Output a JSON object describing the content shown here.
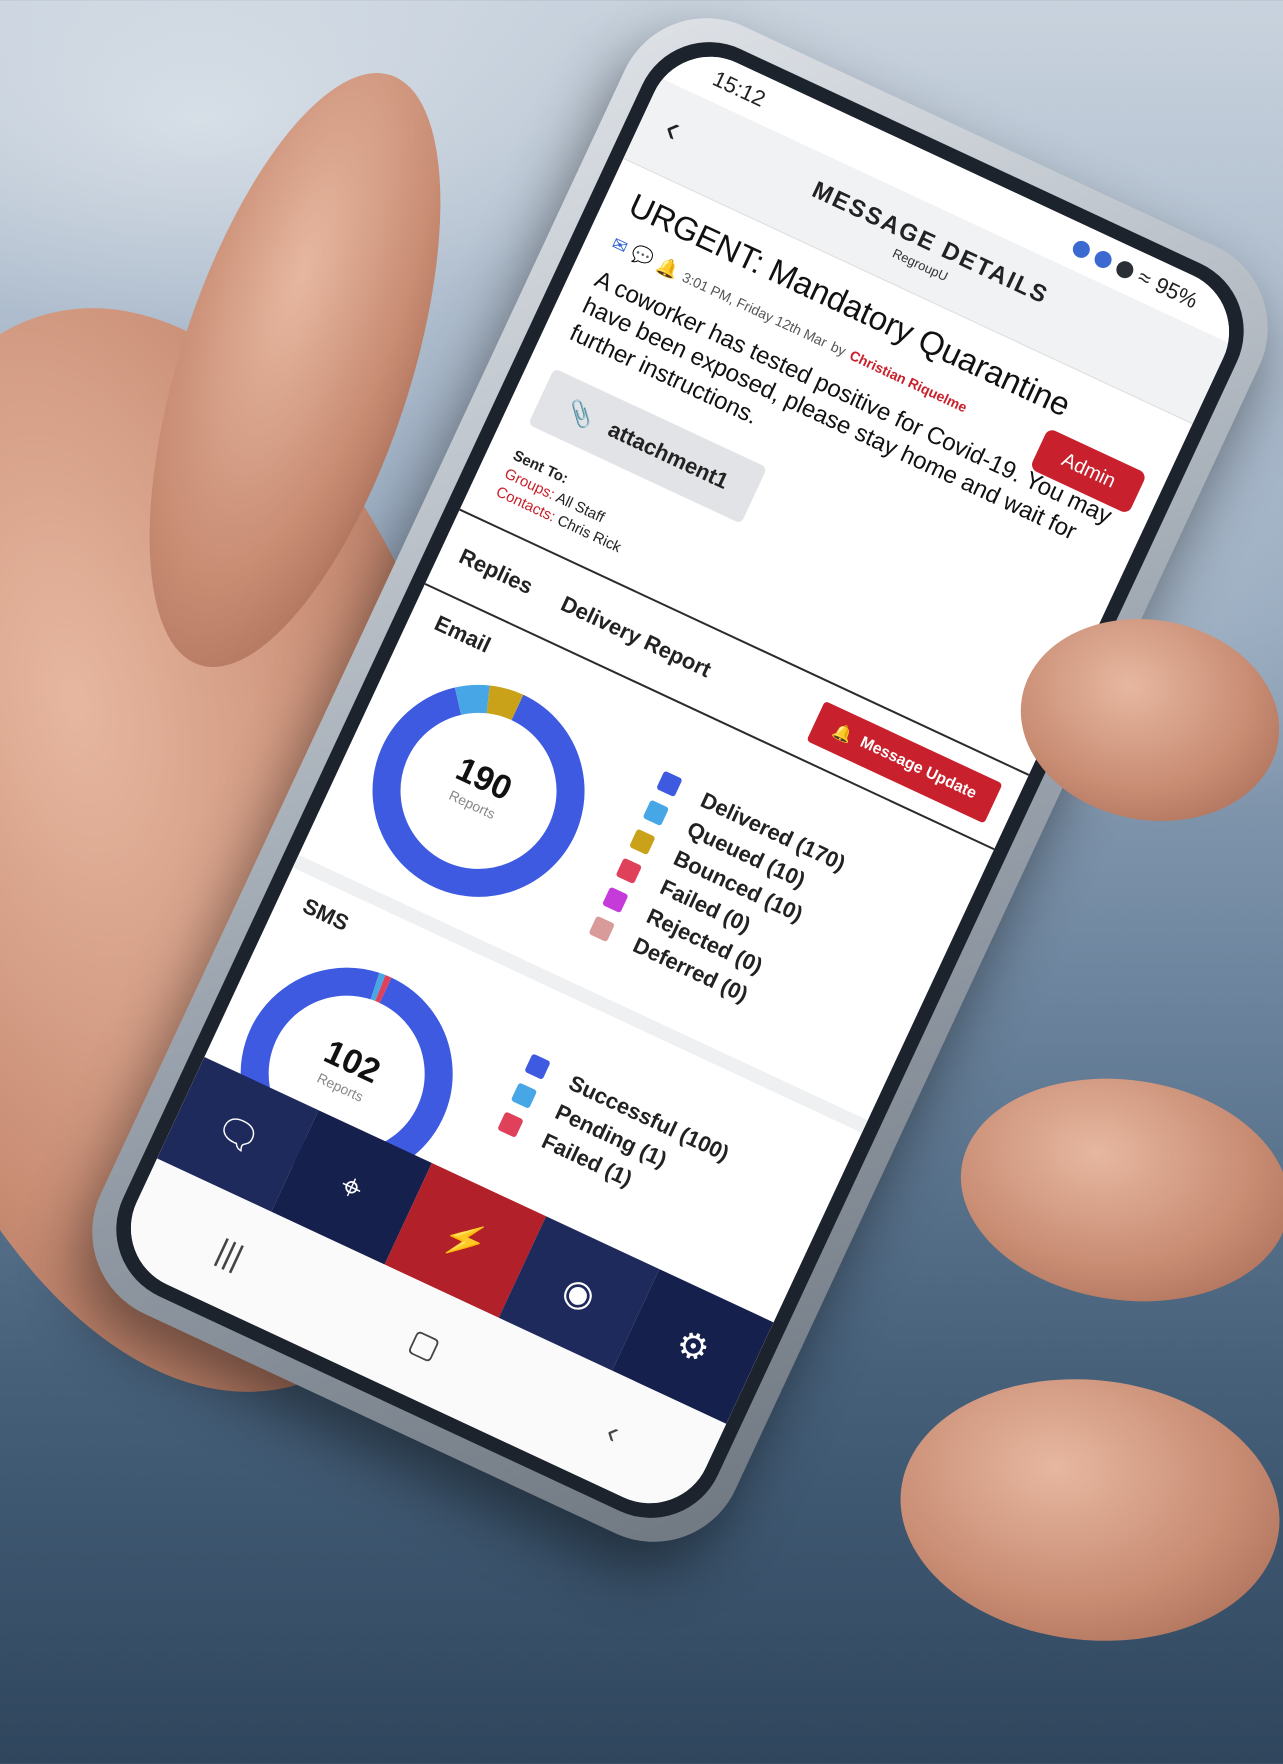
{
  "status_bar": {
    "time": "15:12",
    "battery": "95%"
  },
  "header": {
    "back_icon": "chevron-left-icon",
    "title": "MESSAGE DETAILS",
    "subtitle": "RegroupU"
  },
  "message": {
    "title": "URGENT: Mandatory Quarantine",
    "admin_label": "Admin",
    "meta_time": "3:01 PM, Friday 12th Mar",
    "meta_by": "by",
    "author": "Christian Riquelme",
    "body": "A coworker has tested positive for Covid-19. You may have been exposed, please stay home and wait for further instructions.",
    "attachment": "attachment1",
    "sent_to_label": "Sent To:",
    "groups_label": "Groups:",
    "groups_value": "All Staff",
    "contacts_label": "Contacts:",
    "contacts_value": "Chris Rick"
  },
  "tabs": [
    {
      "label": "Replies"
    },
    {
      "label": "Delivery Report"
    }
  ],
  "message_update_label": "Message Update",
  "email": {
    "title": "Email",
    "total": "190",
    "total_label": "Reports",
    "legend": [
      {
        "label": "Delivered (170)",
        "color": "#3d5ae0",
        "value": 170
      },
      {
        "label": "Queued (10)",
        "color": "#47a7e6",
        "value": 10
      },
      {
        "label": "Bounced (10)",
        "color": "#c9a21a",
        "value": 10
      },
      {
        "label": "Failed (0)",
        "color": "#e0415a",
        "value": 0
      },
      {
        "label": "Rejected (0)",
        "color": "#c43bd9",
        "value": 0
      },
      {
        "label": "Deferred (0)",
        "color": "#d99a9a",
        "value": 0
      }
    ]
  },
  "sms": {
    "title": "SMS",
    "total": "102",
    "total_label": "Reports",
    "legend": [
      {
        "label": "Successful (100)",
        "color": "#3d5ae0",
        "value": 100
      },
      {
        "label": "Pending (1)",
        "color": "#47a7e6",
        "value": 1
      },
      {
        "label": "Failed (1)",
        "color": "#e0415a",
        "value": 1
      }
    ]
  },
  "bottom_nav": [
    {
      "icon": "chat-bubbles-icon"
    },
    {
      "icon": "map-pin-icon"
    },
    {
      "icon": "lightning-icon"
    },
    {
      "icon": "user-circle-icon"
    },
    {
      "icon": "gear-icon"
    }
  ],
  "system_nav": [
    {
      "icon": "recent-apps-icon"
    },
    {
      "icon": "home-icon"
    },
    {
      "icon": "back-icon"
    }
  ]
}
